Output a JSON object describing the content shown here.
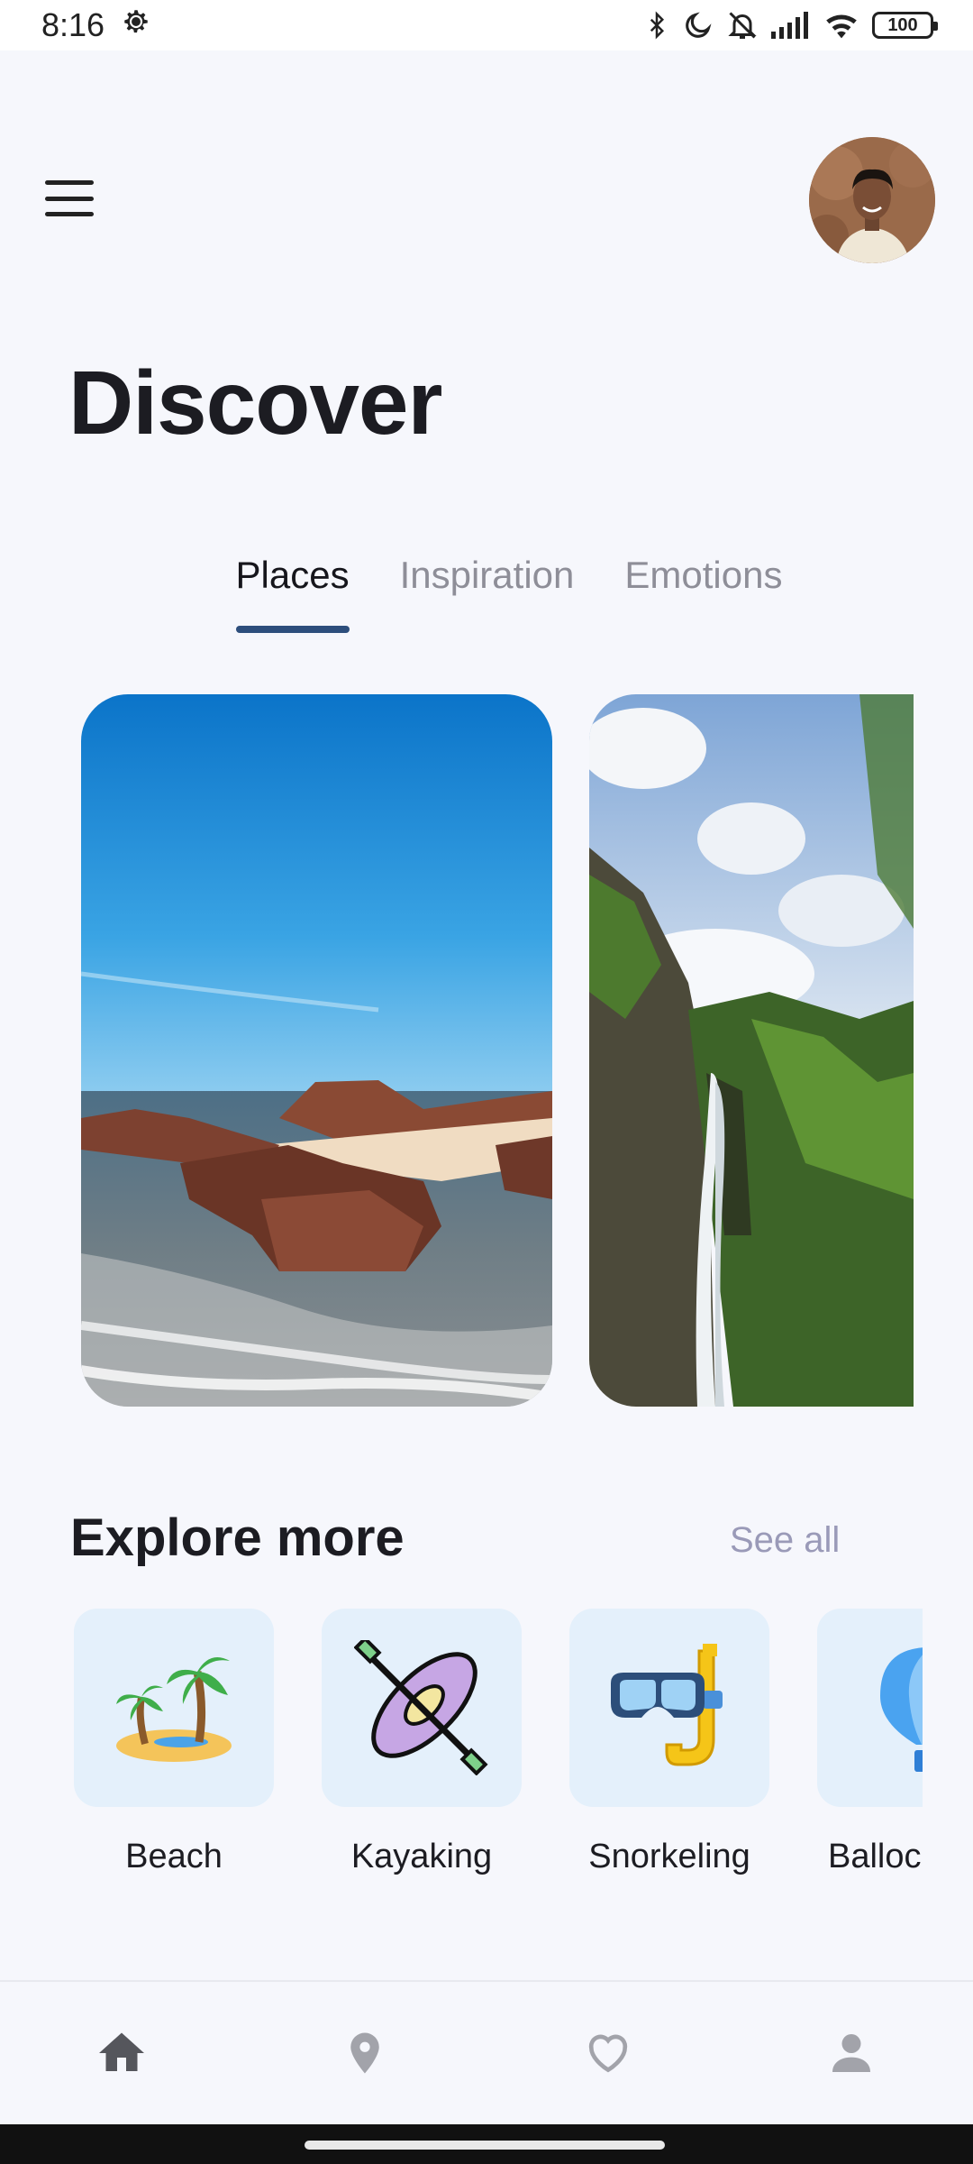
{
  "status_bar": {
    "time": "8:16",
    "battery": "100",
    "icons": [
      "settings-gear-icon",
      "bluetooth-icon",
      "do-not-disturb-moon-icon",
      "muted-bell-icon",
      "signal-icon",
      "wifi-icon",
      "battery-icon"
    ]
  },
  "header": {
    "title": "Discover",
    "menu_icon": "hamburger-menu-icon",
    "avatar": "profile-avatar"
  },
  "tabs": [
    {
      "label": "Places",
      "active": true
    },
    {
      "label": "Inspiration",
      "active": false
    },
    {
      "label": "Emotions",
      "active": false
    }
  ],
  "explore": {
    "title": "Explore more",
    "see_all": "See all",
    "categories": [
      {
        "label": "Beach",
        "icon": "beach-palm-icon"
      },
      {
        "label": "Kayaking",
        "icon": "kayak-icon"
      },
      {
        "label": "Snorkeling",
        "icon": "snorkel-mask-icon"
      },
      {
        "label": "Balloc",
        "icon": "hot-air-balloon-icon"
      }
    ]
  },
  "bottom_nav": [
    {
      "icon": "home-icon",
      "active": true
    },
    {
      "icon": "location-pin-icon",
      "active": false
    },
    {
      "icon": "heart-icon",
      "active": false
    },
    {
      "icon": "user-profile-icon",
      "active": false
    }
  ],
  "colors": {
    "background": "#f6f7fc",
    "tab_indicator": "#2d4e7c",
    "category_tile": "#e4f0fb",
    "see_all": "#9a9ab8"
  }
}
